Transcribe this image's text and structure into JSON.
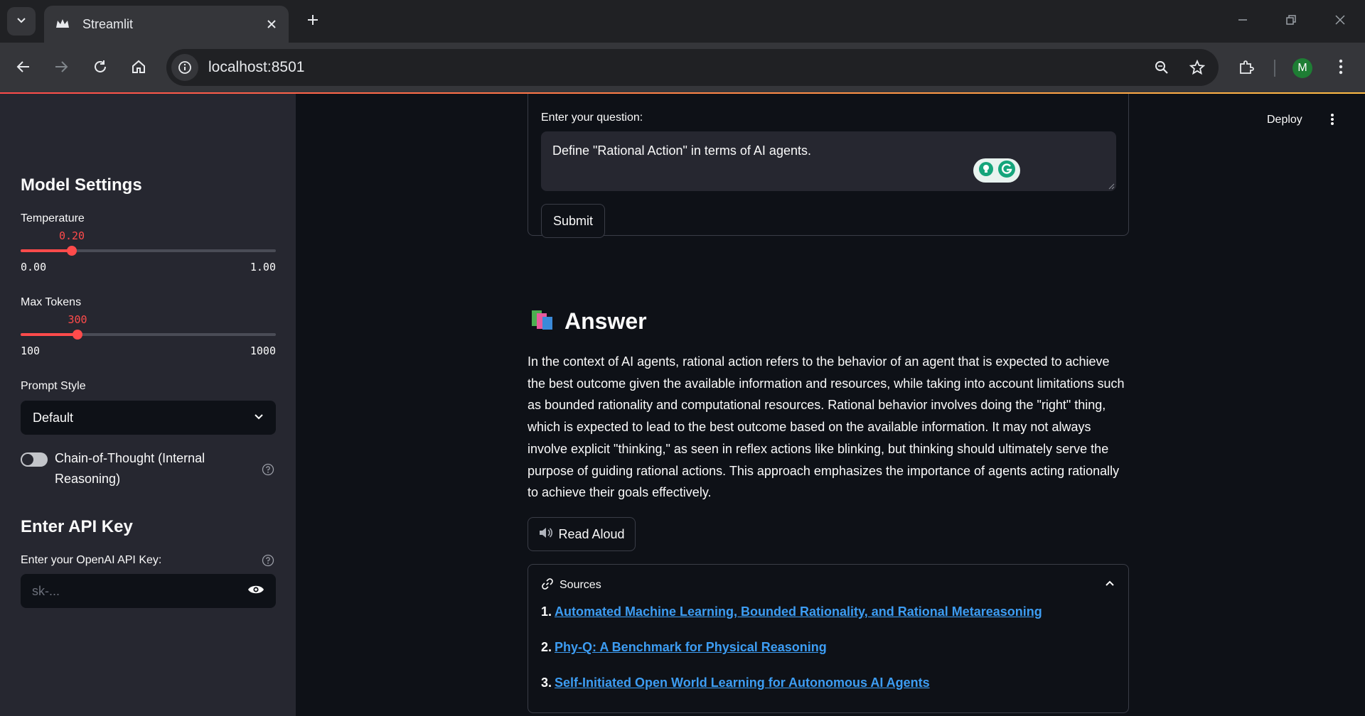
{
  "browser": {
    "tab_title": "Streamlit",
    "url": "localhost:8501",
    "profile_initial": "M"
  },
  "header": {
    "deploy_label": "Deploy"
  },
  "sidebar": {
    "model_settings_heading": "Model Settings",
    "temperature": {
      "label": "Temperature",
      "value": "0.20",
      "min": "0.00",
      "max": "1.00",
      "fraction": 0.2
    },
    "max_tokens": {
      "label": "Max Tokens",
      "value": "300",
      "min": "100",
      "max": "1000",
      "fraction": 0.2222
    },
    "prompt_style": {
      "label": "Prompt Style",
      "selected": "Default"
    },
    "chain_of_thought": {
      "label": "Chain-of-Thought (Internal Reasoning)",
      "enabled": false
    },
    "api_heading": "Enter API Key",
    "api_key": {
      "label": "Enter your OpenAI API Key:",
      "placeholder": "sk-..."
    }
  },
  "main": {
    "question": {
      "label": "Enter your question:",
      "value": "Define \"Rational Action\" in terms of AI agents."
    },
    "submit_label": "Submit",
    "answer_heading": "Answer",
    "answer_text": "In the context of AI agents, rational action refers to the behavior of an agent that is expected to achieve the best outcome given the available information and resources, while taking into account limitations such as bounded rationality and computational resources. Rational behavior involves doing the \"right\" thing, which is expected to lead to the best outcome based on the available information. It may not always involve explicit \"thinking,\" as seen in reflex actions like blinking, but thinking should ultimately serve the purpose of guiding rational actions. This approach emphasizes the importance of agents acting rationally to achieve their goals effectively.",
    "read_aloud_label": "Read Aloud",
    "sources": {
      "title": "Sources",
      "items": [
        {
          "num": "1.",
          "title": "Automated Machine Learning, Bounded Rationality, and Rational Metareasoning"
        },
        {
          "num": "2.",
          "title": "Phy-Q: A Benchmark for Physical Reasoning"
        },
        {
          "num": "3.",
          "title": "Self-Initiated Open World Learning for Autonomous AI Agents"
        }
      ]
    }
  },
  "colors": {
    "accent": "#ff4b4b",
    "link": "#3d9df3",
    "sidebar_bg": "#262730",
    "main_bg": "#0e1117"
  },
  "icons": [
    "chevron-down-icon",
    "streamlit-crown-icon",
    "close-icon",
    "plus-icon",
    "minimize-icon",
    "restore-icon",
    "back-arrow-icon",
    "forward-arrow-icon",
    "reload-icon",
    "home-icon",
    "info-icon",
    "zoom-icon",
    "star-icon",
    "extensions-icon",
    "kebab-menu-icon",
    "help-icon",
    "eye-icon",
    "books-icon",
    "speaker-icon",
    "link-icon",
    "chevron-up-icon"
  ]
}
